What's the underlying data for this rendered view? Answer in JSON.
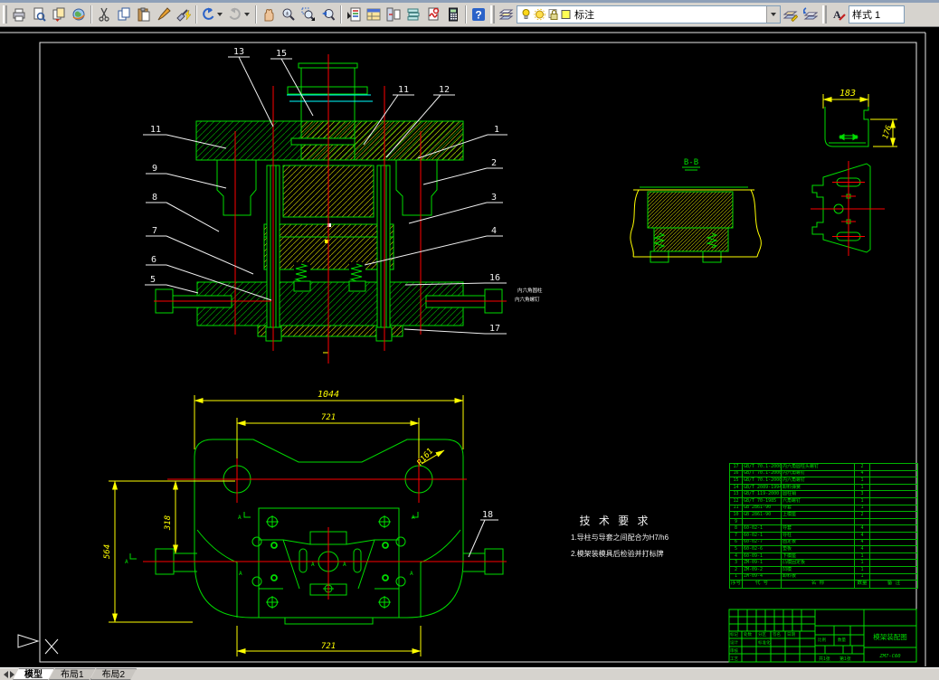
{
  "toolbar": {
    "icons": [
      "plot",
      "print-preview",
      "publish",
      "hyperlink",
      "cut",
      "copy",
      "paste",
      "format-painter",
      "match-properties",
      "undo",
      "redo",
      "pan",
      "zoom-realtime",
      "zoom-window",
      "zoom-previous",
      "properties",
      "designcenter",
      "tool-palettes",
      "sheet-set-manager",
      "markup-set-manager",
      "quickcalc",
      "help",
      "layer-properties-manager",
      "make-object-layer-current",
      "layer-previous",
      "text-style"
    ],
    "layer_combo": {
      "value": "标注",
      "state_icons": [
        "bulb-icon",
        "sun-icon",
        "lock-icon",
        "color-swatch"
      ]
    },
    "style_combo": {
      "value": "样式 1"
    }
  },
  "tabs": {
    "model": "模型",
    "layout1": "布局1",
    "layout2": "布局2"
  },
  "drawing": {
    "callouts": {
      "n1": "1",
      "n2": "2",
      "n3": "3",
      "n4": "4",
      "n5": "5",
      "n6": "6",
      "n7": "7",
      "n8": "8",
      "n9": "9",
      "n11a": "11",
      "n11b": "11",
      "n12": "12",
      "n13": "13",
      "n15": "15",
      "n16": "16",
      "n17": "17",
      "n18": "18"
    },
    "dims": {
      "w1044": "1044",
      "w721top": "721",
      "w721bot": "721",
      "r161": "R161",
      "h318": "318",
      "h564": "564",
      "w183": "183",
      "h176": "176"
    },
    "section_label": "B-B",
    "side_note": {
      "line1": "内六角圆柱",
      "line2": "内六角螺钉"
    },
    "tech_req": {
      "title": "技 术 要 求",
      "line1": "1.导柱与导套之间配合为H7/h6",
      "line2": "2.模架装模具后检验并打标牌"
    },
    "bom": {
      "headers": [
        "序号",
        "代 号",
        "名 称",
        "数量",
        "备 注"
      ],
      "rows": [
        [
          "17",
          "GB/T 70.1-2000",
          "内六角圆柱头螺钉",
          "2",
          ""
        ],
        [
          "16",
          "GB/T 70.1-2000",
          "内六角螺钉",
          "4",
          ""
        ],
        [
          "15",
          "GB/T 70.1-2000",
          "内六角螺钉",
          "1",
          ""
        ],
        [
          "14",
          "GB/T 2089-1994",
          "卸料弹簧",
          "1",
          ""
        ],
        [
          "13",
          "GB/T 119-2000",
          "圆柱销",
          "3",
          ""
        ],
        [
          "12",
          "GB/T 70-1985",
          "六角螺钉",
          "1",
          ""
        ],
        [
          "11",
          "GB 2861-90",
          "导套",
          "1",
          ""
        ],
        [
          "10",
          "GB 2861-90",
          "上模座",
          "2",
          ""
        ],
        [
          "9",
          "",
          "",
          "",
          ""
        ],
        [
          "8",
          "60-02-1",
          "导套",
          "4",
          ""
        ],
        [
          "7",
          "60-02-1",
          "导柱",
          "4",
          ""
        ],
        [
          "6",
          "60-02-7",
          "固定板",
          "4",
          ""
        ],
        [
          "5",
          "60-02-6",
          "垫板",
          "4",
          ""
        ],
        [
          "4",
          "60-09-1",
          "下模座",
          "1",
          ""
        ],
        [
          "3",
          "ZM-09-1",
          "凸模固定板",
          "1",
          ""
        ],
        [
          "2",
          "ZM-09-2",
          "凹模",
          "1",
          ""
        ],
        [
          "1",
          "ZM-09-4",
          "卸料板",
          "1",
          ""
        ]
      ]
    },
    "title_block": {
      "name": "模架装配图",
      "code": "ZM7-C60",
      "labels": {
        "mark": "标记",
        "count": "处数",
        "zone": "分区",
        "sign": "签名",
        "date": "日期",
        "design": "设计",
        "check": "审核",
        "process": "工艺",
        "standard": "标准化",
        "scale": "比例",
        "qty": "数量",
        "sheets": "共1张",
        "sheet_no": "第1张"
      }
    }
  }
}
